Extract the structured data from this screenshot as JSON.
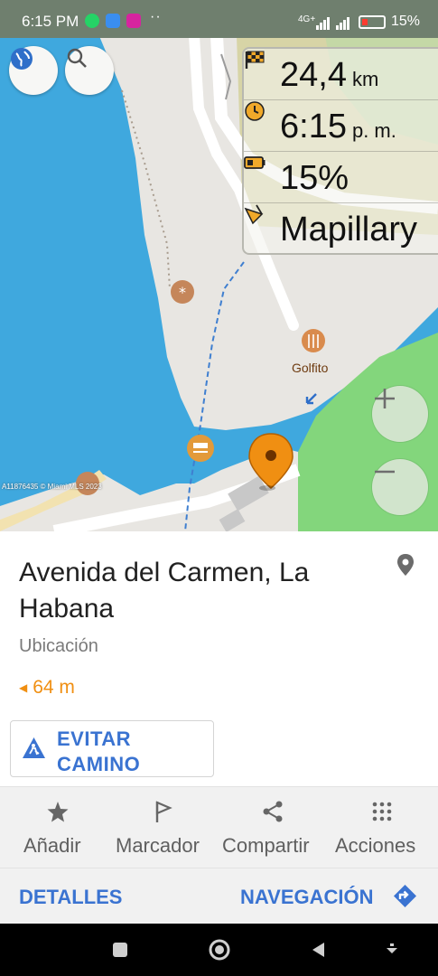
{
  "status_bar": {
    "time": "6:15 PM",
    "dots": "··",
    "network": "4G+",
    "battery_text": "15%"
  },
  "map": {
    "poi_label": "Golfito",
    "copyright": "A11876435 © Miami MLS 2023"
  },
  "info_widget": {
    "distance_value": "24,4",
    "distance_unit": "km",
    "time_value": "6:15",
    "time_unit": "p. m.",
    "battery_value": "15%",
    "layer_value": "Mapillary"
  },
  "place": {
    "title": "Avenida del Carmen, La Habana",
    "type": "Ubicación",
    "distance": "64 m",
    "avoid_label": "EVITAR CAMINO"
  },
  "actions": {
    "add": "Añadir",
    "marker": "Marcador",
    "share": "Compartir",
    "actions": "Acciones"
  },
  "links": {
    "details": "DETALLES",
    "navigation": "NAVEGACIÓN"
  },
  "colors": {
    "water": "#3fa8de",
    "land": "#e8e6e2",
    "park": "#83d67c",
    "accent": "#3a73d1",
    "pin": "#f08f12"
  }
}
